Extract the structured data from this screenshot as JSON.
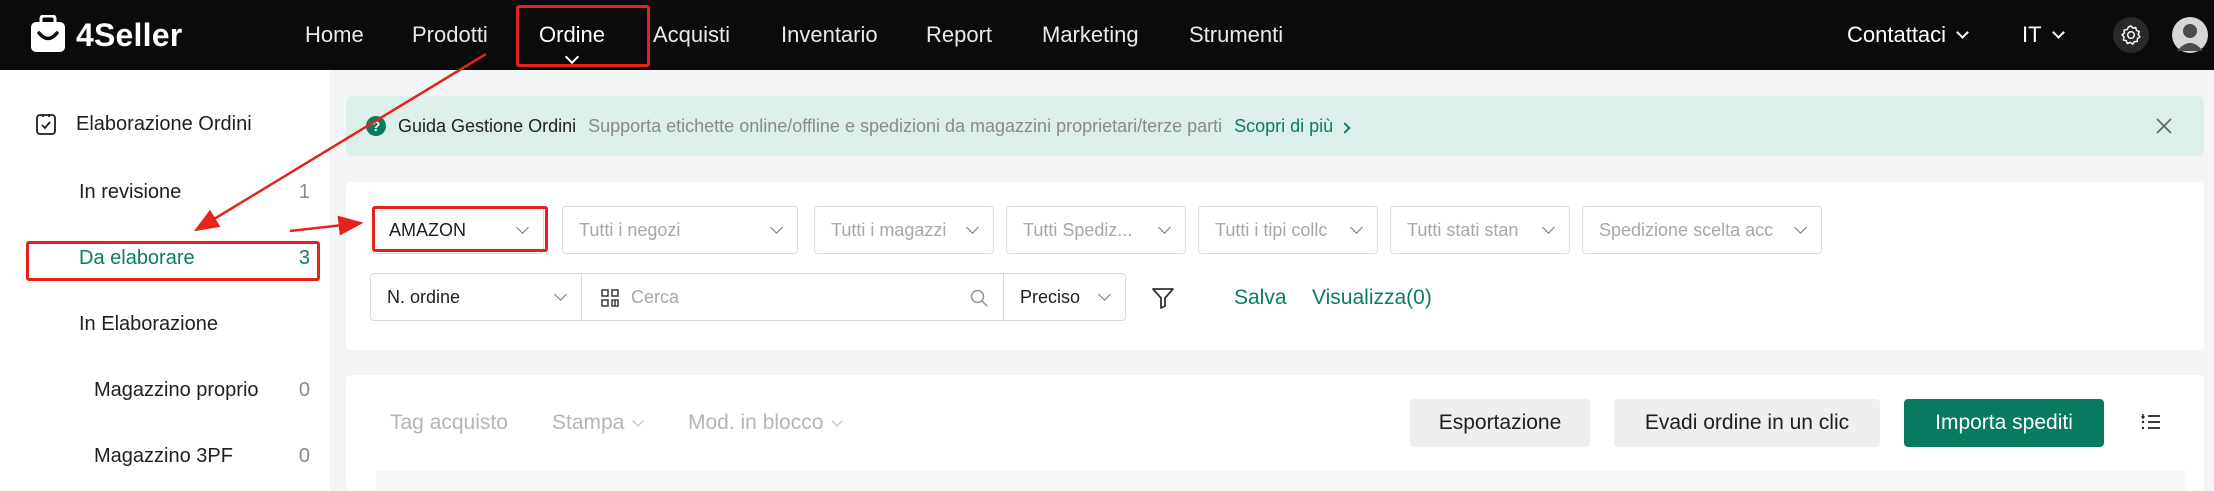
{
  "brand": {
    "name": "4Seller"
  },
  "nav": {
    "items": [
      "Home",
      "Prodotti",
      "Ordine",
      "Acquisti",
      "Inventario",
      "Report",
      "Marketing",
      "Strumenti"
    ],
    "active": "Ordine",
    "contact": "Contattaci",
    "language": "IT"
  },
  "sidebar": {
    "header": "Elaborazione Ordini",
    "items": [
      {
        "label": "In revisione",
        "count": "1"
      },
      {
        "label": "Da elaborare",
        "count": "3"
      },
      {
        "label": "In Elaborazione",
        "count": ""
      },
      {
        "label": "Magazzino proprio",
        "count": "0"
      },
      {
        "label": "Magazzino 3PF",
        "count": "0"
      }
    ],
    "active": "Da elaborare"
  },
  "banner": {
    "title": "Guida Gestione Ordini",
    "desc": "Supporta etichette online/offline e spedizioni da magazzini proprietari/terze parti",
    "link": "Scopri di più"
  },
  "filters": {
    "platform": "AMAZON",
    "shops": "Tutti i negozi",
    "warehouses": "Tutti i magazzi",
    "shipping": "Tutti Spediz...",
    "types": "Tutti i tipi collc",
    "print_status": "Tutti stati stan",
    "shipping_choice": "Spedizione scelta acc",
    "search_field": "N. ordine",
    "search_placeholder": "Cerca",
    "match_mode": "Preciso",
    "save": "Salva",
    "view": "Visualizza(0)"
  },
  "toolbar": {
    "purchase_tag": "Tag acquisto",
    "print": "Stampa",
    "bulk_edit": "Mod. in blocco",
    "export": "Esportazione",
    "one_click": "Evadi ordine in un clic",
    "import_shipped": "Importa spediti"
  },
  "colors": {
    "accent": "#0a7c62",
    "nav_bg": "#0b0b0b",
    "highlight": "#e5221c",
    "banner_bg": "#dcefeb"
  }
}
